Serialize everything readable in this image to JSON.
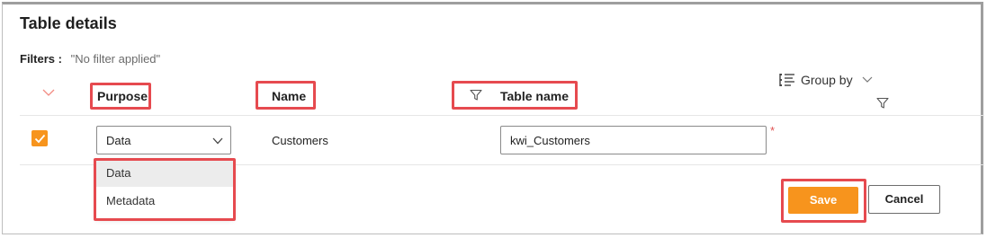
{
  "header": {
    "title": "Table details"
  },
  "filters": {
    "label": "Filters :",
    "value": "\"No filter applied\""
  },
  "columns": {
    "purpose": "Purpose",
    "name": "Name",
    "table_name": "Table name"
  },
  "toolbar": {
    "group_by": "Group by"
  },
  "row": {
    "checked": true,
    "purpose": "Data",
    "name": "Customers",
    "table_name": "kwi_Customers",
    "required_marker": "*"
  },
  "dropdown": {
    "options": [
      "Data",
      "Metadata"
    ],
    "selected": "Data"
  },
  "actions": {
    "save": "Save",
    "cancel": "Cancel"
  },
  "colors": {
    "accent": "#f7941d",
    "highlight": "#e64a4f"
  }
}
